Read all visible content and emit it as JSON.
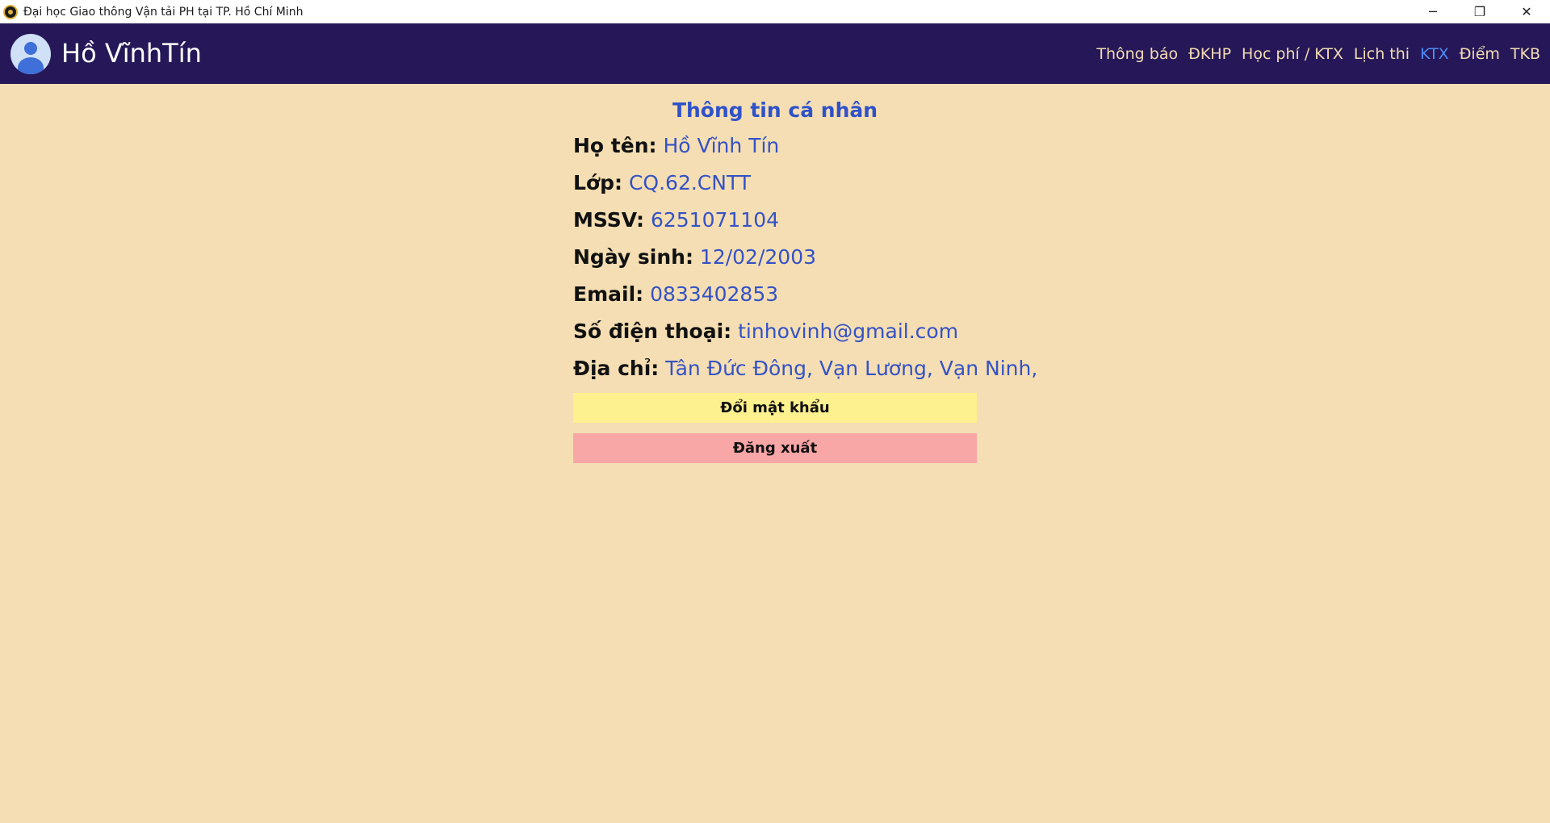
{
  "window": {
    "title": "Đại học Giao thông Vận tải PH tại TP. Hồ Chí Minh",
    "controls": {
      "minimize": "─",
      "restore": "❐",
      "close": "✕"
    }
  },
  "header": {
    "user_name": "Hồ VĩnhTín",
    "nav": [
      {
        "label": "Thông báo",
        "active": false
      },
      {
        "label": "ĐKHP",
        "active": false
      },
      {
        "label": "Học phí / KTX",
        "active": false
      },
      {
        "label": "Lịch thi",
        "active": false
      },
      {
        "label": "KTX",
        "active": true
      },
      {
        "label": "Điểm",
        "active": false
      },
      {
        "label": "TKB",
        "active": false
      }
    ]
  },
  "profile": {
    "title": "Thông tin cá nhân",
    "fields": [
      {
        "label": "Họ tên:",
        "value": "Hồ Vĩnh Tín"
      },
      {
        "label": "Lớp:",
        "value": "CQ.62.CNTT"
      },
      {
        "label": "MSSV:",
        "value": "6251071104"
      },
      {
        "label": "Ngày sinh:",
        "value": "12/02/2003"
      },
      {
        "label": "Email:",
        "value": "0833402853"
      },
      {
        "label": "Số điện thoại:",
        "value": "tinhovinh@gmail.com"
      },
      {
        "label": "Địa chỉ:",
        "value": "Tân Đức Đông, Vạn Lương, Vạn Ninh,"
      }
    ],
    "change_password_label": "Đổi mật khẩu",
    "logout_label": "Đăng xuất"
  },
  "colors": {
    "background": "#f5deb3",
    "header": "#261858",
    "accent": "#3452c6",
    "active_nav": "#4f8cf7",
    "change_button": "#fdf08e",
    "logout_button": "#f9a6a6"
  },
  "icons": {
    "app": "university-logo-icon",
    "avatar": "user-avatar-icon"
  }
}
